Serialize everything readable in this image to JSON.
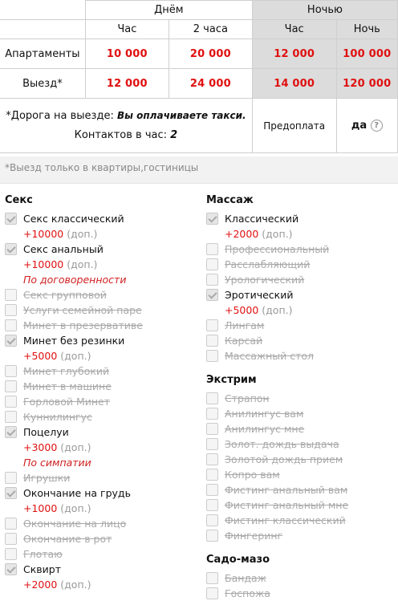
{
  "table": {
    "day_label": "Днём",
    "night_label": "Ночью",
    "col_hour": "Час",
    "col_2hours": "2 часа",
    "col_night_hour": "Час",
    "col_night": "Ночь",
    "rows": [
      {
        "label": "Апартаменты",
        "v1": "10 000",
        "v2": "20 000",
        "v3": "12 000",
        "v4": "100 000"
      },
      {
        "label": "Выезд*",
        "v1": "12 000",
        "v2": "24 000",
        "v3": "14 000",
        "v4": "120 000"
      }
    ],
    "road_label": "*Дорога на выезде:",
    "road_value": "Вы оплачиваете такси.",
    "contacts_label": "Контактов в час:",
    "contacts_value": "2",
    "prepay_label": "Предоплата",
    "prepay_value": "да",
    "help_glyph": "?"
  },
  "note": "*Выезд только в квартиры,гостиницы",
  "left": {
    "title": "Секс",
    "items": [
      {
        "label": "Секс классический",
        "on": true,
        "plus": "+10000",
        "dop": "(доп.)"
      },
      {
        "label": "Секс анальный",
        "on": true,
        "plus": "+10000",
        "dop": "(доп.)",
        "note": "По договоренности"
      },
      {
        "label": "Секс групповой",
        "on": false
      },
      {
        "label": "Услуги семейной паре",
        "on": false
      },
      {
        "label": "Минет в презервативе",
        "on": false
      },
      {
        "label": "Минет без резинки",
        "on": true,
        "plus": "+5000",
        "dop": "(доп.)"
      },
      {
        "label": "Минет глубокий",
        "on": false
      },
      {
        "label": "Минет в машине",
        "on": false
      },
      {
        "label": "Горловой Минет",
        "on": false
      },
      {
        "label": "Куннилингус",
        "on": false
      },
      {
        "label": "Поцелуи",
        "on": true,
        "plus": "+3000",
        "dop": "(доп.)",
        "note": "По симпатии"
      },
      {
        "label": "Игрушки",
        "on": false
      },
      {
        "label": "Окончание на грудь",
        "on": true,
        "plus": "+1000",
        "dop": "(доп.)"
      },
      {
        "label": "Окончание на лицо",
        "on": false
      },
      {
        "label": "Окончание в рот",
        "on": false
      },
      {
        "label": "Глотаю",
        "on": false
      },
      {
        "label": "Сквирт",
        "on": true,
        "plus": "+2000",
        "dop": "(доп.)"
      }
    ]
  },
  "massage": {
    "title": "Массаж",
    "items": [
      {
        "label": "Классический",
        "on": true,
        "plus": "+2000",
        "dop": "(доп.)"
      },
      {
        "label": "Профессиональный",
        "on": false
      },
      {
        "label": "Расслабляющий",
        "on": false
      },
      {
        "label": "Урологический",
        "on": false
      },
      {
        "label": "Эротический",
        "on": true,
        "plus": "+5000",
        "dop": "(доп.)"
      },
      {
        "label": "Лингам",
        "on": false
      },
      {
        "label": "Карсай",
        "on": false
      },
      {
        "label": "Массажный стол",
        "on": false
      }
    ]
  },
  "extreme": {
    "title": "Экстрим",
    "items": [
      {
        "label": "Страпон",
        "on": false
      },
      {
        "label": "Анилингус вам",
        "on": false
      },
      {
        "label": "Анилингус мне",
        "on": false
      },
      {
        "label": "Золот. дождь выдача",
        "on": false
      },
      {
        "label": "Золотой дождь прием",
        "on": false
      },
      {
        "label": "Копро вам",
        "on": false
      },
      {
        "label": "Фистинг анальный вам",
        "on": false
      },
      {
        "label": "Фистинг анальный мне",
        "on": false
      },
      {
        "label": "Фистинг классический",
        "on": false
      },
      {
        "label": "Фингеринг",
        "on": false
      }
    ]
  },
  "sado": {
    "title": "Садо-мазо",
    "items": [
      {
        "label": "Бандаж",
        "on": false
      },
      {
        "label": "Госпожа",
        "on": false
      }
    ]
  }
}
